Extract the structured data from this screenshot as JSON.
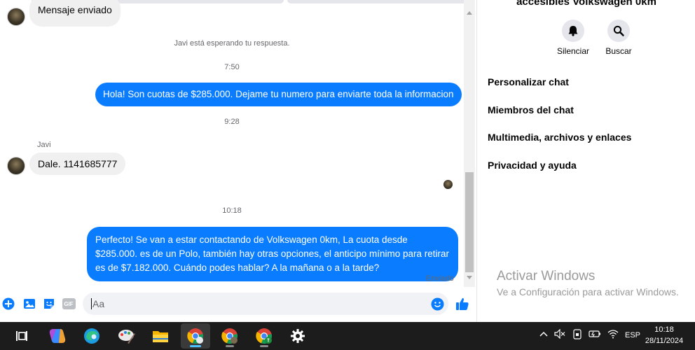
{
  "chat": {
    "top_message": "Mensaje enviado",
    "waiting_note": "Javi está esperando tu respuesta.",
    "time_1": "7:50",
    "out_message_1": "Hola! Son cuotas de $285.000. Dejame tu numero para enviarte toda la informacion",
    "time_2": "9:28",
    "sender_name": "Javi",
    "in_message_1": "Dale. 1141685777",
    "time_3": "10:18",
    "out_message_2": "Perfecto!  Se van a estar contactando de Volkswagen 0km, La cuota desde $285.000. es de un Polo, también hay otras opciones, el anticipo mínimo para retirar es de $7.182.000. Cuándo podes hablar? A la mañana o a la tarde?",
    "status": "Enviado"
  },
  "composer": {
    "placeholder": "Aa",
    "icons": [
      "plus-circle-icon",
      "image-icon",
      "sticker-icon",
      "gif-icon",
      "emoji-icon",
      "like-icon"
    ],
    "gif_label": "GIF"
  },
  "side": {
    "title": "accesibles Volkswagen 0km",
    "actions": [
      {
        "label": "Silenciar",
        "icon": "bell-icon"
      },
      {
        "label": "Buscar",
        "icon": "search-icon"
      }
    ],
    "items": [
      {
        "label": "Personalizar chat"
      },
      {
        "label": "Miembros del chat"
      },
      {
        "label": "Multimedia, archivos y enlaces"
      },
      {
        "label": "Privacidad y ayuda"
      }
    ],
    "activate_title": "Activar Windows",
    "activate_sub": "Ve a Configuración para activar Windows."
  },
  "taskbar": {
    "apps": [
      "task-view-icon",
      "copilot-icon",
      "edge-icon",
      "paint-icon",
      "file-explorer-icon",
      "chrome-icon",
      "chrome-profile-icon",
      "chrome-profile-t-icon",
      "settings-icon"
    ],
    "language": "ESP",
    "time": "10:18",
    "date": "28/11/2024"
  },
  "colors": {
    "accent": "#0a7cff",
    "incoming_bubble": "#f0f0f0",
    "taskbar": "#1c1c1c"
  }
}
